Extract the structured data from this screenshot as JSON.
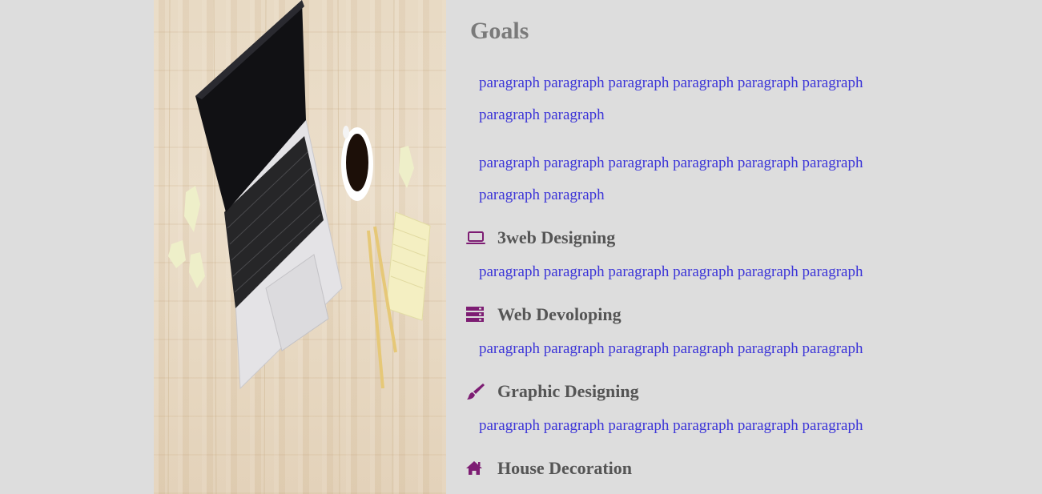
{
  "colors": {
    "background": "#dddddd",
    "heading": "#7a7a7a",
    "service_heading": "#555555",
    "paragraph": "#3c35d8",
    "icon": "#7d1d73"
  },
  "hero_image": {
    "icon": "laptop-on-desk-photo"
  },
  "goals": {
    "title": "Goals",
    "paragraphs": [
      "paragraph paragraph paragraph paragraph paragraph paragraph paragraph paragraph",
      "paragraph paragraph paragraph paragraph paragraph paragraph paragraph paragraph"
    ]
  },
  "services": [
    {
      "icon": "laptop-icon",
      "title": "3web Designing",
      "text": "paragraph paragraph paragraph paragraph paragraph paragraph"
    },
    {
      "icon": "server-icon",
      "title": "Web Devoloping",
      "text": "paragraph paragraph paragraph paragraph paragraph paragraph"
    },
    {
      "icon": "paint-brush-icon",
      "title": "Graphic Designing",
      "text": "paragraph paragraph paragraph paragraph paragraph paragraph"
    },
    {
      "icon": "home-icon",
      "title": "House Decoration",
      "text": ""
    }
  ]
}
